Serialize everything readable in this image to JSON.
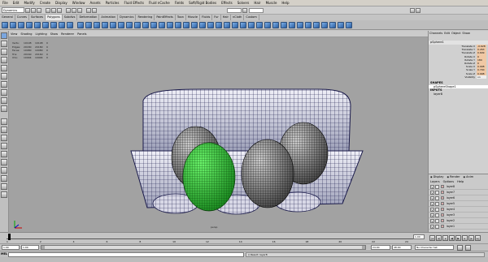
{
  "menubar": {
    "items": [
      "File",
      "Edit",
      "Modify",
      "Create",
      "Display",
      "Window",
      "Assets",
      "Particles",
      "Fluid Effects",
      "Fluid nCache",
      "Fields",
      "Soft/Rigid Bodies",
      "Effects",
      "Solvers",
      "Hair",
      "Muscle",
      "Help"
    ]
  },
  "statusline": {
    "mode": "Dynamics"
  },
  "shelf": {
    "tabs": [
      "General",
      "Curves",
      "Surfaces",
      "Polygons",
      "Subdivs",
      "Deformation",
      "Animation",
      "Dynamics",
      "Rendering",
      "PaintEffects",
      "Toon",
      "Muscle",
      "Fluids",
      "Fur",
      "Hair",
      "nCloth",
      "Custom"
    ],
    "active_tab": "Polygons"
  },
  "viewport": {
    "menu": [
      "View",
      "Shading",
      "Lighting",
      "Show",
      "Renderer",
      "Panels"
    ],
    "hud": [
      {
        "label": "Verts:",
        "a": "10108",
        "b": "10108",
        "c": "0"
      },
      {
        "label": "Edges:",
        "a": "20180",
        "b": "20180",
        "c": "0"
      },
      {
        "label": "Faces:",
        "a": "10080",
        "b": "10080",
        "c": "0"
      },
      {
        "label": "Tris:",
        "a": "20160",
        "b": "20160",
        "c": "0"
      },
      {
        "label": "UVs:",
        "a": "10904",
        "b": "10904",
        "c": "0"
      }
    ],
    "camera": "persp",
    "selection_color": "#2fcf2f",
    "wire_color": "#1a1a4a"
  },
  "channel_box": {
    "menu": [
      "Channels",
      "Edit",
      "Object",
      "Show"
    ],
    "object_name": "pSphere1",
    "attributes": [
      {
        "label": "Translate X",
        "value": "-0.628"
      },
      {
        "label": "Translate Y",
        "value": "0.263"
      },
      {
        "label": "Translate Z",
        "value": "0.699"
      },
      {
        "label": "Rotate X",
        "value": "0"
      },
      {
        "label": "Rotate Y",
        "value": "180"
      },
      {
        "label": "Rotate Z",
        "value": "0"
      },
      {
        "label": "Scale X",
        "value": "0.998"
      },
      {
        "label": "Scale Y",
        "value": "0.700"
      },
      {
        "label": "Scale Z",
        "value": "0.998"
      },
      {
        "label": "Visibility",
        "value": "on"
      }
    ],
    "shapes_header": "SHAPES",
    "shape_name": "pSphereShape1",
    "inputs_header": "INPUTS",
    "input_name": "layer8"
  },
  "layers": {
    "tabs": [
      "Display",
      "Render",
      "Anim"
    ],
    "menu": [
      "Layers",
      "Options",
      "Help"
    ],
    "items": [
      "layer8",
      "layer7",
      "layer6",
      "layer5",
      "layer4",
      "layer3",
      "layer2",
      "layer1"
    ],
    "visible_flag": "V"
  },
  "timeline": {
    "ticks": [
      "1",
      "2",
      "4",
      "6",
      "8",
      "10",
      "12",
      "14",
      "16",
      "18",
      "20",
      "22",
      "24"
    ],
    "current_frame": "1.00",
    "start": "1.00",
    "start2": "1.00",
    "end": "24.00",
    "end2": "48.00",
    "character_set": "No Character Set"
  },
  "command_line": {
    "lang": "MEL",
    "result": "// Result: layer8"
  }
}
